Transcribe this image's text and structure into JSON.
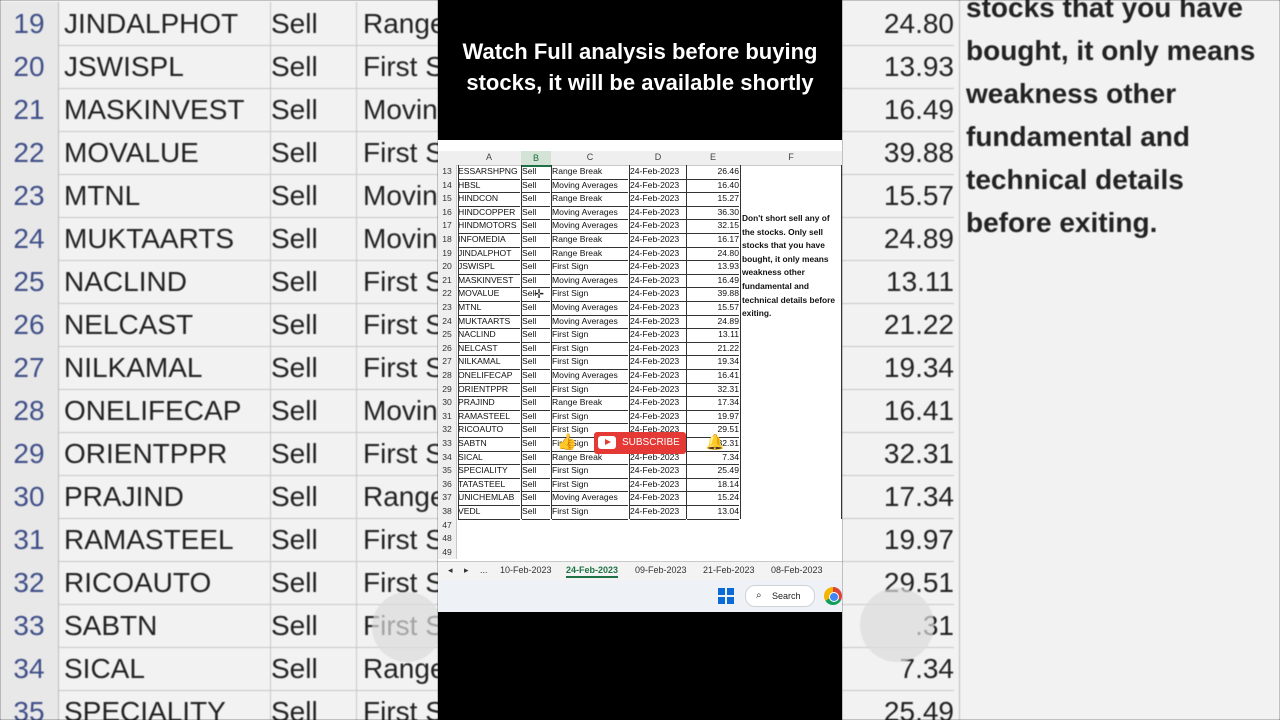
{
  "headline": "Watch Full analysis before buying stocks, it will be available shortly",
  "columns": [
    "A",
    "B",
    "C",
    "D",
    "E",
    "F"
  ],
  "rows": [
    {
      "n": "13",
      "sym": "ESSARSHPNG",
      "side": "Sell",
      "strategy": "Range Break",
      "date": "24-Feb-2023",
      "price": "26.46"
    },
    {
      "n": "14",
      "sym": "HBSL",
      "side": "Sell",
      "strategy": "Moving Averages",
      "date": "24-Feb-2023",
      "price": "16.40"
    },
    {
      "n": "15",
      "sym": "HINDCON",
      "side": "Sell",
      "strategy": "Range Break",
      "date": "24-Feb-2023",
      "price": "15.27"
    },
    {
      "n": "16",
      "sym": "HINDCOPPER",
      "side": "Sell",
      "strategy": "Moving Averages",
      "date": "24-Feb-2023",
      "price": "36.30"
    },
    {
      "n": "17",
      "sym": "HINDMOTORS",
      "side": "Sell",
      "strategy": "Moving Averages",
      "date": "24-Feb-2023",
      "price": "32.15"
    },
    {
      "n": "18",
      "sym": "INFOMEDIA",
      "side": "Sell",
      "strategy": "Range Break",
      "date": "24-Feb-2023",
      "price": "16.17"
    },
    {
      "n": "19",
      "sym": "JINDALPHOT",
      "side": "Sell",
      "strategy": "Range Break",
      "date": "24-Feb-2023",
      "price": "24.80"
    },
    {
      "n": "20",
      "sym": "JSWISPL",
      "side": "Sell",
      "strategy": "First Sign",
      "date": "24-Feb-2023",
      "price": "13.93"
    },
    {
      "n": "21",
      "sym": "MASKINVEST",
      "side": "Sell",
      "strategy": "Moving Averages",
      "date": "24-Feb-2023",
      "price": "16.49"
    },
    {
      "n": "22",
      "sym": "MOVALUE",
      "side": "Sell",
      "strategy": "First Sign",
      "date": "24-Feb-2023",
      "price": "39.88"
    },
    {
      "n": "23",
      "sym": "MTNL",
      "side": "Sell",
      "strategy": "Moving Averages",
      "date": "24-Feb-2023",
      "price": "15.57"
    },
    {
      "n": "24",
      "sym": "MUKTAARTS",
      "side": "Sell",
      "strategy": "Moving Averages",
      "date": "24-Feb-2023",
      "price": "24.89"
    },
    {
      "n": "25",
      "sym": "NACLIND",
      "side": "Sell",
      "strategy": "First Sign",
      "date": "24-Feb-2023",
      "price": "13.11"
    },
    {
      "n": "26",
      "sym": "NELCAST",
      "side": "Sell",
      "strategy": "First Sign",
      "date": "24-Feb-2023",
      "price": "21.22"
    },
    {
      "n": "27",
      "sym": "NILKAMAL",
      "side": "Sell",
      "strategy": "First Sign",
      "date": "24-Feb-2023",
      "price": "19.34"
    },
    {
      "n": "28",
      "sym": "ONELIFECAP",
      "side": "Sell",
      "strategy": "Moving Averages",
      "date": "24-Feb-2023",
      "price": "16.41"
    },
    {
      "n": "29",
      "sym": "ORIENTPPR",
      "side": "Sell",
      "strategy": "First Sign",
      "date": "24-Feb-2023",
      "price": "32.31"
    },
    {
      "n": "30",
      "sym": "PRAJIND",
      "side": "Sell",
      "strategy": "Range Break",
      "date": "24-Feb-2023",
      "price": "17.34"
    },
    {
      "n": "31",
      "sym": "RAMASTEEL",
      "side": "Sell",
      "strategy": "First Sign",
      "date": "24-Feb-2023",
      "price": "19.97"
    },
    {
      "n": "32",
      "sym": "RICOAUTO",
      "side": "Sell",
      "strategy": "First Sign",
      "date": "24-Feb-2023",
      "price": "29.51"
    },
    {
      "n": "33",
      "sym": "SABTN",
      "side": "Sell",
      "strategy": "First Sign",
      "date": "24-Feb-2023",
      "price": "32.31"
    },
    {
      "n": "34",
      "sym": "SICAL",
      "side": "Sell",
      "strategy": "Range Break",
      "date": "24-Feb-2023",
      "price": "7.34"
    },
    {
      "n": "35",
      "sym": "SPECIALITY",
      "side": "Sell",
      "strategy": "First Sign",
      "date": "24-Feb-2023",
      "price": "25.49"
    },
    {
      "n": "36",
      "sym": "TATASTEEL",
      "side": "Sell",
      "strategy": "First Sign",
      "date": "24-Feb-2023",
      "price": "18.14"
    },
    {
      "n": "37",
      "sym": "UNICHEMLAB",
      "side": "Sell",
      "strategy": "Moving Averages",
      "date": "24-Feb-2023",
      "price": "15.24"
    },
    {
      "n": "38",
      "sym": "VEDL",
      "side": "Sell",
      "strategy": "First Sign",
      "date": "24-Feb-2023",
      "price": "13.04"
    }
  ],
  "empty_rows": [
    "47",
    "48",
    "49"
  ],
  "note": "Don't short sell any of the stocks. Only sell stocks that you have bought, it only means weakness other fundamental and technical details before exiting.",
  "bg_left_rows": [
    {
      "n": "19",
      "sym": "JINDALPHOT",
      "side": "Sell",
      "strategy": "Range"
    },
    {
      "n": "20",
      "sym": "JSWISPL",
      "side": "Sell",
      "strategy": "First S"
    },
    {
      "n": "21",
      "sym": "MASKINVEST",
      "side": "Sell",
      "strategy": "Movin"
    },
    {
      "n": "22",
      "sym": "MOVALUE",
      "side": "Sell",
      "strategy": "First S"
    },
    {
      "n": "23",
      "sym": "MTNL",
      "side": "Sell",
      "strategy": "Movin"
    },
    {
      "n": "24",
      "sym": "MUKTAARTS",
      "side": "Sell",
      "strategy": "Movin"
    },
    {
      "n": "25",
      "sym": "NACLIND",
      "side": "Sell",
      "strategy": "First S"
    },
    {
      "n": "26",
      "sym": "NELCAST",
      "side": "Sell",
      "strategy": "First S"
    },
    {
      "n": "27",
      "sym": "NILKAMAL",
      "side": "Sell",
      "strategy": "First S"
    },
    {
      "n": "28",
      "sym": "ONELIFECAP",
      "side": "Sell",
      "strategy": "Movin"
    },
    {
      "n": "29",
      "sym": "ORIENTPPR",
      "side": "Sell",
      "strategy": "First S"
    },
    {
      "n": "30",
      "sym": "PRAJIND",
      "side": "Sell",
      "strategy": "Range"
    },
    {
      "n": "31",
      "sym": "RAMASTEEL",
      "side": "Sell",
      "strategy": "First S"
    },
    {
      "n": "32",
      "sym": "RICOAUTO",
      "side": "Sell",
      "strategy": "First S"
    },
    {
      "n": "33",
      "sym": "SABTN",
      "side": "Sell",
      "strategy": "First S"
    },
    {
      "n": "34",
      "sym": "SICAL",
      "side": "Sell",
      "strategy": "Range"
    },
    {
      "n": "35",
      "sym": "SPECIALITY",
      "side": "Sell",
      "strategy": "First S"
    }
  ],
  "bg_right_values": [
    "24.80",
    "13.93",
    "16.49",
    "39.88",
    "15.57",
    "24.89",
    "13.11",
    "21.22",
    "19.34",
    "16.41",
    "32.31",
    "17.34",
    "19.97",
    "29.51",
    ".31",
    "7.34",
    "25.49"
  ],
  "bg_note": "stocks that you have bought, it only means weakness other fundamental and technical details before exiting.",
  "tabs": {
    "prev": "◂",
    "next": "▸",
    "more": "...",
    "list": [
      "10-Feb-2023",
      "24-Feb-2023",
      "09-Feb-2023",
      "21-Feb-2023",
      "08-Feb-2023"
    ],
    "active": "24-Feb-2023"
  },
  "overlay": {
    "subscribe": "SUBSCRIBE",
    "like_icon": "thumbs-up-icon",
    "bell_icon": "bell-icon"
  },
  "taskbar": {
    "search": "Search"
  },
  "colors": {
    "excel_green": "#1e7145",
    "subscribe_red": "#e53935",
    "windows_blue": "#0a6bd6"
  }
}
